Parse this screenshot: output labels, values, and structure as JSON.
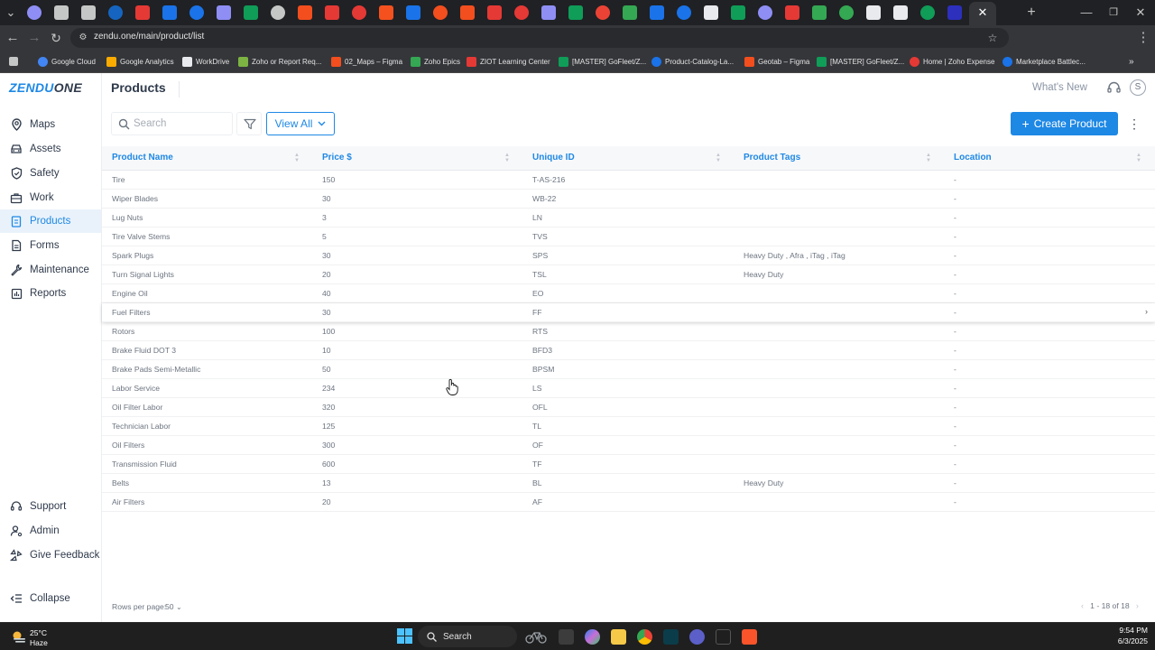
{
  "browser": {
    "url": "zendu.one/main/product/list",
    "bookmarks": [
      "Google Cloud",
      "Google Analytics",
      "WorkDrive",
      "Zoho or Report Req...",
      "02_Maps – Figma",
      "Zoho Epics",
      "ZIOT Learning Center",
      "[MASTER] GoFleet/Z...",
      "Product-Catalog-La...",
      "Geotab – Figma",
      "[MASTER] GoFleet/Z...",
      "Home | Zoho Expense",
      "Marketplace Battlec..."
    ]
  },
  "app": {
    "logo": "ZENDUONE",
    "page_title": "Products",
    "whats_new": "What's New",
    "avatar_initial": "S",
    "search_placeholder": "Search",
    "view_all_label": "View All",
    "create_label": "Create Product",
    "accent": "#1e88e5"
  },
  "sidebar": {
    "items": [
      {
        "label": "Maps",
        "icon": "map-pin-icon"
      },
      {
        "label": "Assets",
        "icon": "car-icon"
      },
      {
        "label": "Safety",
        "icon": "shield-icon"
      },
      {
        "label": "Work",
        "icon": "briefcase-icon"
      },
      {
        "label": "Products",
        "icon": "clipboard-icon"
      },
      {
        "label": "Forms",
        "icon": "form-icon"
      },
      {
        "label": "Maintenance",
        "icon": "wrench-icon"
      },
      {
        "label": "Reports",
        "icon": "chart-icon"
      }
    ],
    "bottom": [
      {
        "label": "Support",
        "icon": "support-icon"
      },
      {
        "label": "Admin",
        "icon": "admin-icon"
      },
      {
        "label": "Give Feedback",
        "icon": "feedback-icon"
      }
    ],
    "collapse_label": "Collapse"
  },
  "table": {
    "headers": [
      "Product Name",
      "Price $",
      "Unique ID",
      "Product Tags",
      "Location"
    ],
    "rows": [
      [
        "Tire",
        "150",
        "T-AS-216",
        "",
        "-"
      ],
      [
        "Wiper Blades",
        "30",
        "WB-22",
        "",
        "-"
      ],
      [
        "Lug Nuts",
        "3",
        "LN",
        "",
        "-"
      ],
      [
        "Tire Valve Stems",
        "5",
        "TVS",
        "",
        "-"
      ],
      [
        "Spark Plugs",
        "30",
        "SPS",
        "Heavy Duty , Afra , iTag , iTag",
        "-"
      ],
      [
        "Turn Signal Lights",
        "20",
        "TSL",
        "Heavy Duty",
        "-"
      ],
      [
        "Engine Oil",
        "40",
        "EO",
        "",
        "-"
      ],
      [
        "Fuel Filters",
        "30",
        "FF",
        "",
        "-"
      ],
      [
        "Rotors",
        "100",
        "RTS",
        "",
        "-"
      ],
      [
        "Brake Fluid DOT 3",
        "10",
        "BFD3",
        "",
        "-"
      ],
      [
        "Brake Pads Semi-Metallic",
        "50",
        "BPSM",
        "",
        "-"
      ],
      [
        "Labor Service",
        "234",
        "LS",
        "",
        "-"
      ],
      [
        "Oil Filter Labor",
        "320",
        "OFL",
        "",
        "-"
      ],
      [
        "Technician Labor",
        "125",
        "TL",
        "",
        "-"
      ],
      [
        "Oil Filters",
        "300",
        "OF",
        "",
        "-"
      ],
      [
        "Transmission Fluid",
        "600",
        "TF",
        "",
        "-"
      ],
      [
        "Belts",
        "13",
        "BL",
        "Heavy Duty",
        "-"
      ],
      [
        "Air Filters",
        "20",
        "AF",
        "",
        "-"
      ]
    ],
    "hovered_row": 7
  },
  "footer": {
    "rows_per_page_label": "Rows per page:",
    "rows_per_page_value": "50",
    "page_info": "1 - 18 of 18"
  },
  "taskbar": {
    "temp": "25°C",
    "weather": "Haze",
    "search": "Search",
    "time": "9:54 PM",
    "date": "6/3/2025"
  }
}
